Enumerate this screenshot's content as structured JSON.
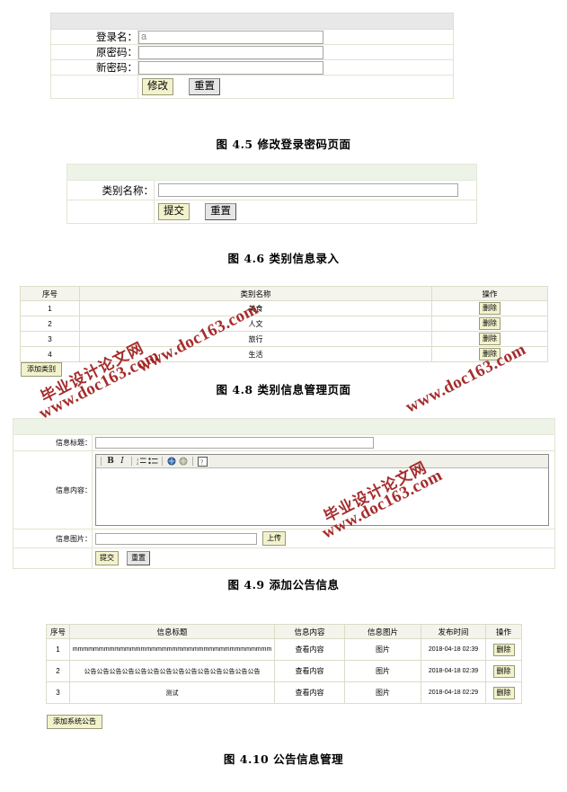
{
  "figures": {
    "f45": {
      "caption": "图 4.5 修改登录密码页面",
      "fields": [
        {
          "label": "登录名：",
          "value": "a",
          "placeholder": ""
        },
        {
          "label": "原密码：",
          "value": "",
          "placeholder": ""
        },
        {
          "label": "新密码：",
          "value": "",
          "placeholder": ""
        }
      ],
      "buttons": {
        "submit": "修改",
        "reset": "重置"
      }
    },
    "f46": {
      "caption": "图 4.6 类别信息录入",
      "fields": [
        {
          "label": "类别名称：",
          "value": "",
          "placeholder": ""
        }
      ],
      "buttons": {
        "submit": "提交",
        "reset": "重置"
      }
    },
    "f48": {
      "caption": "图 4.8 类别信息管理页面",
      "columns": [
        "序号",
        "类别名称",
        "操作"
      ],
      "rows": [
        {
          "index": "1",
          "name": "美食",
          "action": "删除"
        },
        {
          "index": "2",
          "name": "人文",
          "action": "删除"
        },
        {
          "index": "3",
          "name": "旅行",
          "action": "删除"
        },
        {
          "index": "4",
          "name": "生活",
          "action": "删除"
        }
      ],
      "add_button": "添加类别"
    },
    "f49": {
      "caption": "图 4.9 添加公告信息",
      "fields": {
        "title_label": "信息标题：",
        "title_value": "",
        "content_label": "信息内容：",
        "content_value": "",
        "image_label": "信息图片：",
        "image_value": "",
        "upload_button": "上传"
      },
      "toolbar_icons": [
        "bold-icon",
        "italic-icon",
        "ordered-list-icon",
        "unordered-list-icon",
        "insert-link-icon",
        "insert-image-icon",
        "help-icon"
      ],
      "buttons": {
        "submit": "提交",
        "reset": "重置"
      }
    },
    "f410": {
      "caption": "图 4.10 公告信息管理",
      "columns": [
        "序号",
        "信息标题",
        "信息内容",
        "信息图片",
        "发布时间",
        "操作"
      ],
      "rows": [
        {
          "index": "1",
          "title": "mmmmmmmmmmmmmmmmmmmmmmmmmmmmmmmmmmmmmm",
          "content": "查看内容",
          "image": "图片",
          "time": "2018-04-18 02:39",
          "action": "删除"
        },
        {
          "index": "2",
          "title": "公告公告公告公告公告公告公告公告公告公告公告公告公告公告",
          "content": "查看内容",
          "image": "图片",
          "time": "2018-04-18 02:39",
          "action": "删除"
        },
        {
          "index": "3",
          "title": "测试",
          "content": "查看内容",
          "image": "图片",
          "time": "2018-04-18 02:29",
          "action": "删除"
        }
      ],
      "add_button": "添加系统公告"
    }
  },
  "watermarks": {
    "cn": "毕业设计论文网",
    "url": "www.doc163.com"
  },
  "colors": {
    "accent_button": "#f2f2cd",
    "accent_border": "#9a9a78",
    "panel_header": "#e8e8e8",
    "panel_header_green": "#eef3e8",
    "grid_header": "#f4f4ec",
    "grid_border": "#dcdcc8",
    "watermark": "#9e1b1b"
  }
}
